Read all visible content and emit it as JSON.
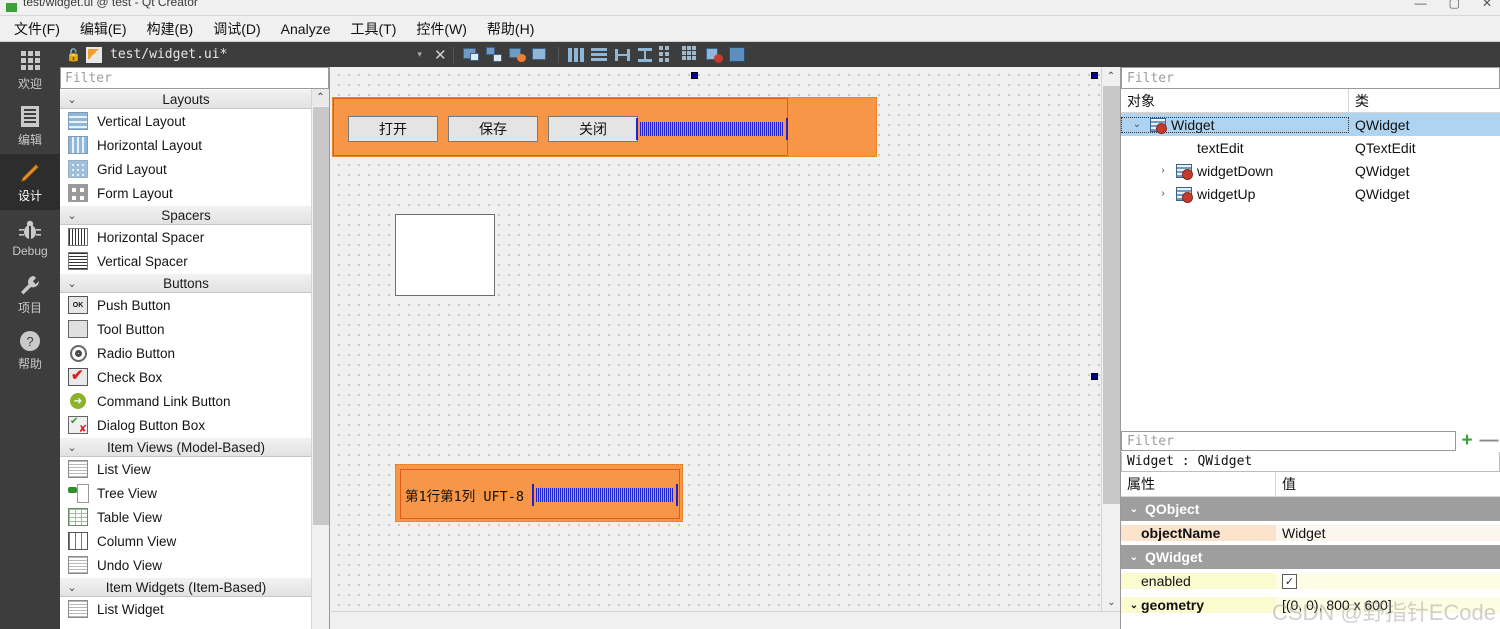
{
  "window": {
    "title": "test/widget.ui @ test - Qt Creator",
    "min_label": "—",
    "max_label": "▢",
    "close_label": "✕"
  },
  "menubar": {
    "items": [
      {
        "label": "文件(F)",
        "name": "menu-file"
      },
      {
        "label": "编辑(E)",
        "name": "menu-edit"
      },
      {
        "label": "构建(B)",
        "name": "menu-build"
      },
      {
        "label": "调试(D)",
        "name": "menu-debug"
      },
      {
        "label": "Analyze",
        "name": "menu-analyze"
      },
      {
        "label": "工具(T)",
        "name": "menu-tools"
      },
      {
        "label": "控件(W)",
        "name": "menu-window"
      },
      {
        "label": "帮助(H)",
        "name": "menu-help"
      }
    ]
  },
  "modebar": {
    "items": [
      {
        "label": "欢迎",
        "icon": "grid-icon",
        "active": false
      },
      {
        "label": "编辑",
        "icon": "document-icon",
        "active": false
      },
      {
        "label": "设计",
        "icon": "pencil-icon",
        "active": true
      },
      {
        "label": "Debug",
        "icon": "bug-icon",
        "active": false
      },
      {
        "label": "项目",
        "icon": "wrench-icon",
        "active": false
      },
      {
        "label": "帮助",
        "icon": "question-icon",
        "active": false
      }
    ]
  },
  "toolbar": {
    "file_label": "test/widget.ui*",
    "lock_icon": "unlock-icon",
    "dropdown_caret": "▾",
    "close_label": "✕",
    "icons": [
      "edit-widgets-icon",
      "edit-signals-icon",
      "edit-buddies-icon",
      "edit-tab-order-icon",
      "layout-horizontal-icon",
      "layout-vertical-icon",
      "layout-splitter-h-icon",
      "layout-splitter-v-icon",
      "layout-form-icon",
      "layout-grid-icon",
      "break-layout-icon",
      "adjust-size-icon"
    ]
  },
  "widgetbox": {
    "filter_placeholder": "Filter",
    "scroll_up": "⌃",
    "categories": [
      {
        "name": "Layouts",
        "chevron": "⌄",
        "items": [
          {
            "label": "Vertical Layout",
            "icon": "vertical-layout-icon"
          },
          {
            "label": "Horizontal Layout",
            "icon": "horizontal-layout-icon"
          },
          {
            "label": "Grid Layout",
            "icon": "grid-layout-icon"
          },
          {
            "label": "Form Layout",
            "icon": "form-layout-icon"
          }
        ]
      },
      {
        "name": "Spacers",
        "chevron": "⌄",
        "items": [
          {
            "label": "Horizontal Spacer",
            "icon": "horizontal-spacer-icon"
          },
          {
            "label": "Vertical Spacer",
            "icon": "vertical-spacer-icon"
          }
        ]
      },
      {
        "name": "Buttons",
        "chevron": "⌄",
        "items": [
          {
            "label": "Push Button",
            "icon": "push-button-icon"
          },
          {
            "label": "Tool Button",
            "icon": "tool-button-icon"
          },
          {
            "label": "Radio Button",
            "icon": "radio-button-icon"
          },
          {
            "label": "Check Box",
            "icon": "check-box-icon"
          },
          {
            "label": "Command Link Button",
            "icon": "command-link-icon"
          },
          {
            "label": "Dialog Button Box",
            "icon": "dialog-button-box-icon"
          }
        ]
      },
      {
        "name": "Item Views (Model-Based)",
        "chevron": "⌄",
        "items": [
          {
            "label": "List View",
            "icon": "list-view-icon"
          },
          {
            "label": "Tree View",
            "icon": "tree-view-icon"
          },
          {
            "label": "Table View",
            "icon": "table-view-icon"
          },
          {
            "label": "Column View",
            "icon": "column-view-icon"
          },
          {
            "label": "Undo View",
            "icon": "undo-view-icon"
          }
        ]
      },
      {
        "name": "Item Widgets (Item-Based)",
        "chevron": "⌄",
        "items": [
          {
            "label": "List Widget",
            "icon": "list-widget-icon"
          }
        ]
      }
    ]
  },
  "canvas": {
    "top_form": {
      "buttons": [
        "打开",
        "保存",
        "关闭"
      ],
      "spacer_name": "horizontal-spacer"
    },
    "bottom_form": {
      "status_text": "第1行第1列 UFT-8",
      "spacer_name": "horizontal-spacer"
    },
    "textedit_name": "textEdit"
  },
  "object_tree": {
    "filter_placeholder": "Filter",
    "columns": [
      "对象",
      "类"
    ],
    "rows": [
      {
        "name": "Widget",
        "class": "QWidget",
        "indent": 0,
        "twisty": "⌄",
        "icon": "widget-icon",
        "selected": true
      },
      {
        "name": "textEdit",
        "class": "QTextEdit",
        "indent": 1,
        "twisty": "",
        "icon": "",
        "selected": false
      },
      {
        "name": "widgetDown",
        "class": "QWidget",
        "indent": 1,
        "twisty": "›",
        "icon": "widget-icon",
        "selected": false
      },
      {
        "name": "widgetUp",
        "class": "QWidget",
        "indent": 1,
        "twisty": "›",
        "icon": "widget-icon",
        "selected": false
      }
    ]
  },
  "property_editor": {
    "filter_placeholder": "Filter",
    "add_label": "+",
    "remove_label": "—",
    "subject": "Widget : QWidget",
    "columns": [
      "属性",
      "值"
    ],
    "rows": [
      {
        "kind": "group",
        "key": "QObject",
        "value": "",
        "twisty": "⌄",
        "tone": ""
      },
      {
        "kind": "prop",
        "key": "objectName",
        "value": "Widget",
        "twisty": "",
        "tone": "tone-a",
        "bold": true
      },
      {
        "kind": "group",
        "key": "QWidget",
        "value": "",
        "twisty": "⌄",
        "tone": ""
      },
      {
        "kind": "prop",
        "key": "enabled",
        "value": "",
        "twisty": "",
        "tone": "tone-b",
        "bold": false,
        "checkbox": true,
        "checked": true
      },
      {
        "kind": "prop",
        "key": "geometry",
        "value": "[(0, 0), 800 x 600]",
        "twisty": "⌄",
        "tone": "tone-b",
        "bold": true
      }
    ]
  },
  "watermark": {
    "text": "CSDN @野指针ECode"
  },
  "colors": {
    "accent_orange": "#f79646",
    "selection_blue": "#aed4f2",
    "spacer_blue": "#2222cc",
    "dark_chrome": "#3d3d3d"
  }
}
